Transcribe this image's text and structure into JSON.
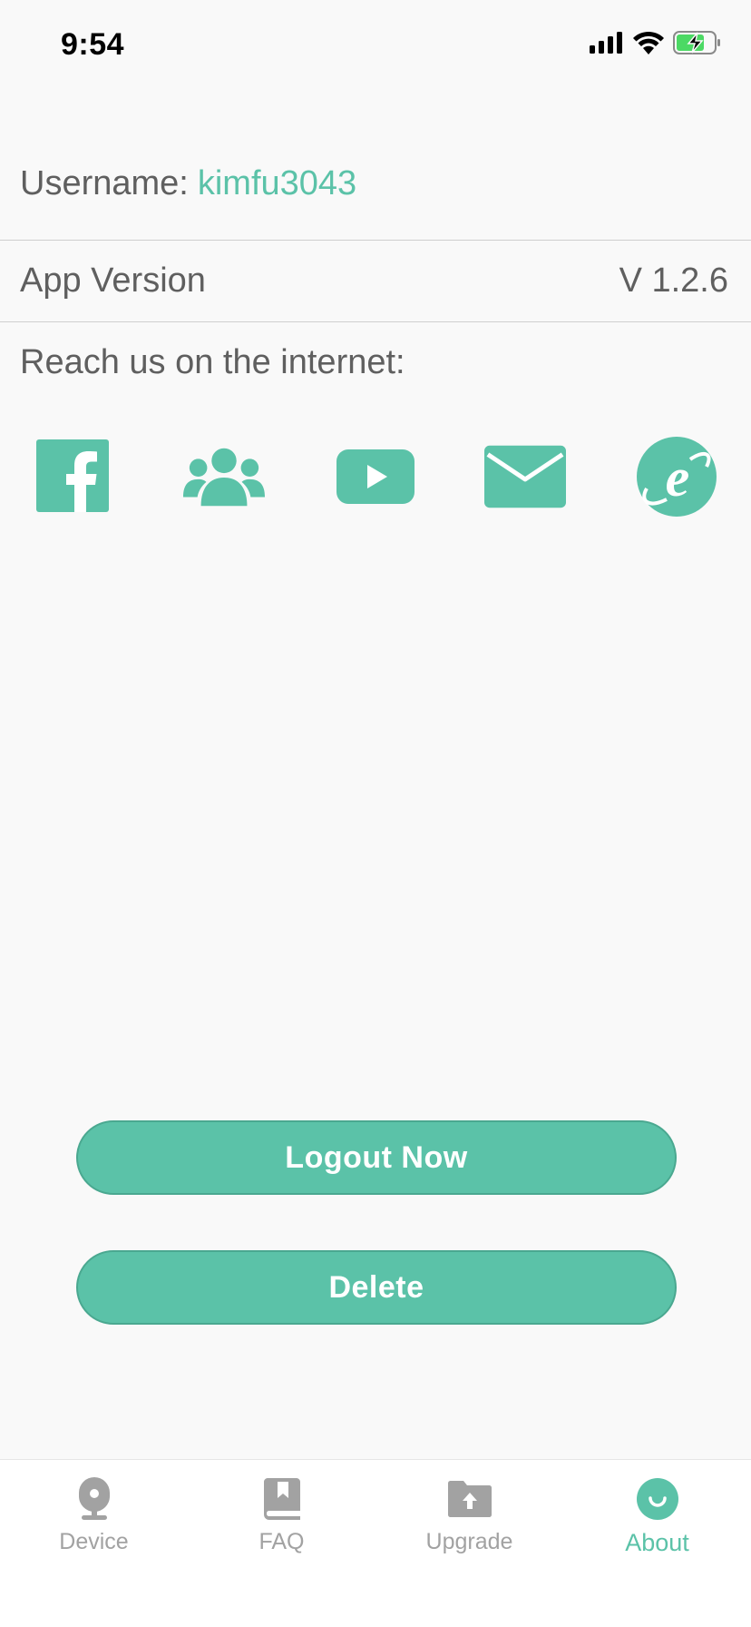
{
  "status_bar": {
    "time": "9:54",
    "icons": [
      "cellular-signal-icon",
      "wifi-icon",
      "battery-charging-icon"
    ]
  },
  "account": {
    "username_label": "Username:",
    "username_value": "kimfu3043"
  },
  "version": {
    "label": "App Version",
    "value": "V 1.2.6"
  },
  "social": {
    "label": "Reach us on the internet:",
    "icons": [
      "facebook-icon",
      "community-icon",
      "youtube-icon",
      "email-icon",
      "internet-explorer-icon"
    ]
  },
  "actions": {
    "logout_label": "Logout Now",
    "delete_label": "Delete"
  },
  "tab_bar": {
    "items": [
      {
        "label": "Device",
        "icon": "camera-icon",
        "active": false
      },
      {
        "label": "FAQ",
        "icon": "book-icon",
        "active": false
      },
      {
        "label": "Upgrade",
        "icon": "upload-folder-icon",
        "active": false
      },
      {
        "label": "About",
        "icon": "smile-icon",
        "active": true
      }
    ]
  },
  "colors": {
    "accent": "#5bc2a8",
    "text": "#5f5f5f",
    "inactive_tab": "#a2a2a2",
    "background": "#f9f9f9"
  }
}
